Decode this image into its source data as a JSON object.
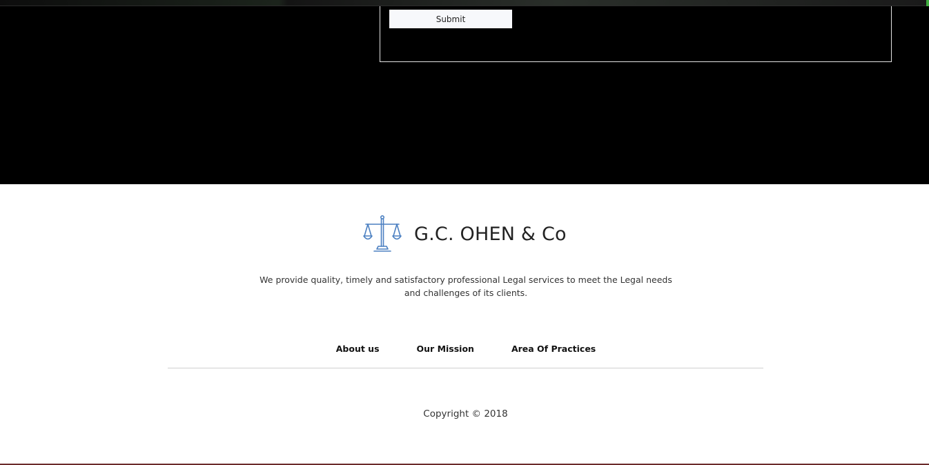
{
  "contact_form": {
    "submit_label": "Submit"
  },
  "footer": {
    "brand_name": "G.C. OHEN & Co",
    "logo_icon": "scales-of-justice-icon",
    "tagline_line1": "We provide quality, timely and satisfactory professional Legal services to meet the Legal needs",
    "tagline_line2": "and challenges of its clients.",
    "nav": [
      {
        "label": "About us"
      },
      {
        "label": "Our Mission"
      },
      {
        "label": "Area Of Practices"
      }
    ],
    "copyright": "Copyright © 2018"
  },
  "colors": {
    "dark_background": "#000000",
    "footer_background": "#ffffff",
    "logo_blue": "#4a7fc1",
    "text_dark": "#222222"
  }
}
